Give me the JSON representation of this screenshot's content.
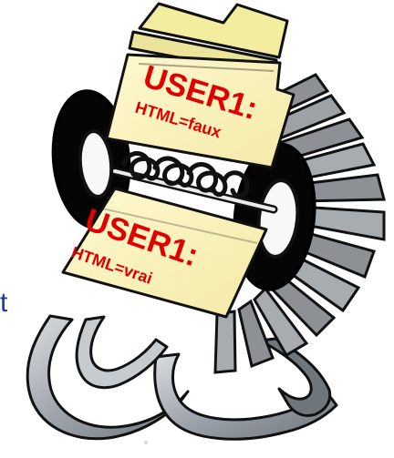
{
  "illustration": {
    "cards": [
      {
        "user_label": "USER1:",
        "html_setting": "HTML=faux"
      },
      {
        "user_label": "USER1:",
        "html_setting": "HTML=vrai"
      }
    ],
    "partial_left_text": "t",
    "colors": {
      "card": "#fff5b7",
      "text": "#e00000",
      "outline": "#111111",
      "metal": "#a7acb2",
      "dark_roller": "#050505",
      "blue_text": "#1f3a94"
    }
  }
}
